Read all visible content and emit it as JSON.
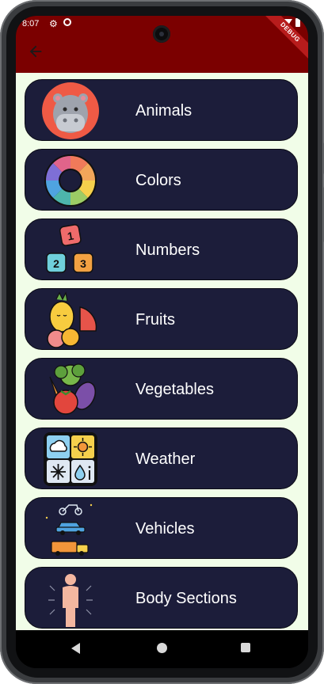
{
  "status_bar": {
    "time": "8:07"
  },
  "app_bar": {
    "back_icon": "arrow-left-icon",
    "debug_banner": "DEBUG",
    "color": "#7b0000"
  },
  "categories": [
    {
      "label": "Animals",
      "icon": "hippo-icon"
    },
    {
      "label": "Colors",
      "icon": "color-wheel-icon"
    },
    {
      "label": "Numbers",
      "icon": "number-blocks-icon"
    },
    {
      "label": "Fruits",
      "icon": "fruits-icon"
    },
    {
      "label": "Vegetables",
      "icon": "vegetables-icon"
    },
    {
      "label": "Weather",
      "icon": "weather-icon"
    },
    {
      "label": "Vehicles",
      "icon": "vehicles-icon"
    },
    {
      "label": "Body Sections",
      "icon": "human-body-icon"
    }
  ],
  "colors": {
    "card_bg": "#1c1d3a",
    "page_bg": "#f1fde8",
    "text": "#ffffff"
  }
}
